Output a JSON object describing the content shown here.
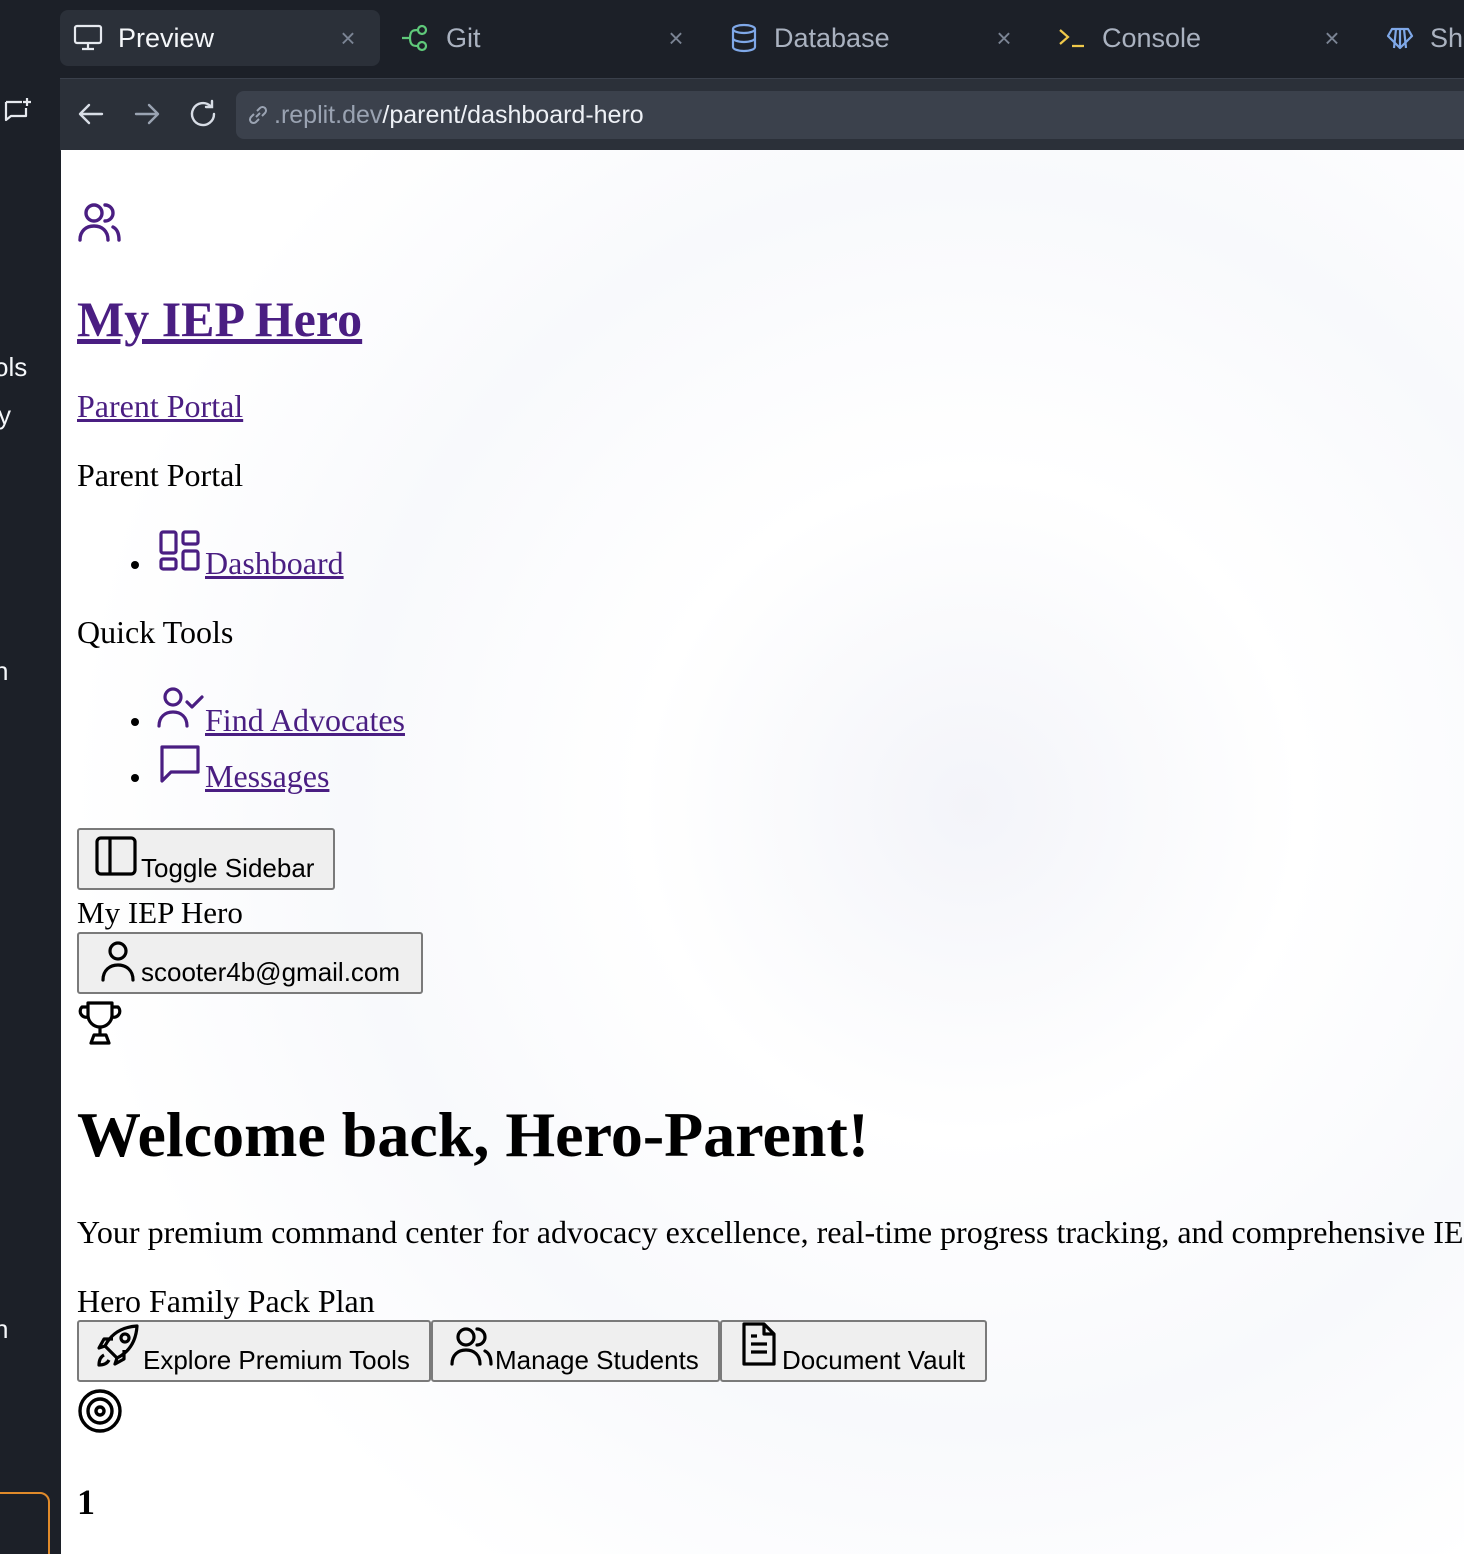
{
  "left_rail": {
    "fragments": [
      "ols",
      "y",
      "n",
      "n"
    ]
  },
  "tabs": [
    {
      "label": "Preview",
      "icon": "monitor-icon",
      "active": true
    },
    {
      "label": "Git",
      "icon": "git-branch-icon",
      "active": false
    },
    {
      "label": "Database",
      "icon": "database-icon",
      "active": false
    },
    {
      "label": "Console",
      "icon": "terminal-icon",
      "active": false
    },
    {
      "label": "She",
      "icon": "shell-icon",
      "active": false
    }
  ],
  "tab_close_glyph": "×",
  "urlbar": {
    "host": ".replit.dev",
    "path": "/parent/dashboard-hero"
  },
  "page": {
    "app_title": "My IEP Hero",
    "portal_link": "Parent Portal",
    "portal_heading": "Parent Portal",
    "nav_dashboard": "Dashboard",
    "quick_tools_heading": "Quick Tools",
    "quick_tools": [
      "Find Advocates",
      "Messages"
    ],
    "toggle_sidebar": "Toggle Sidebar",
    "brand_text": "My IEP Hero",
    "user_email": "scooter4b@gmail.com",
    "welcome_heading": "Welcome back, Hero-Parent!",
    "welcome_subtext": "Your premium command center for advocacy excellence, real-time progress tracking, and comprehensive IEP",
    "plan_name": "Hero Family Pack Plan",
    "actions": [
      "Explore Premium Tools",
      "Manage Students",
      "Document Vault"
    ],
    "stat_value": "1"
  },
  "colors": {
    "link_purple": "#4a1e82",
    "ide_background": "#1c2028",
    "tab_active": "#2b3039",
    "accent_orange": "#e08a2a"
  }
}
